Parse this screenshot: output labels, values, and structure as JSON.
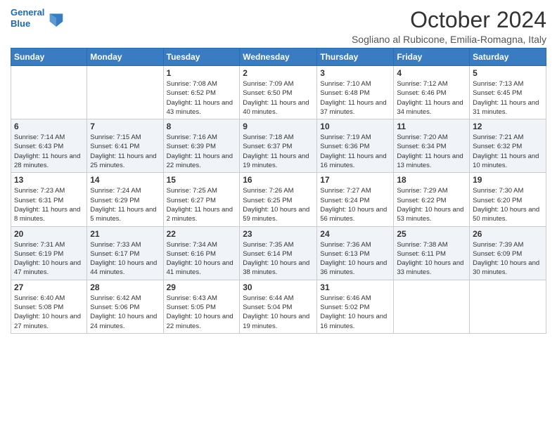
{
  "header": {
    "logo_line1": "General",
    "logo_line2": "Blue",
    "month_title": "October 2024",
    "subtitle": "Sogliano al Rubicone, Emilia-Romagna, Italy"
  },
  "weekdays": [
    "Sunday",
    "Monday",
    "Tuesday",
    "Wednesday",
    "Thursday",
    "Friday",
    "Saturday"
  ],
  "weeks": [
    [
      {
        "day": "",
        "info": ""
      },
      {
        "day": "",
        "info": ""
      },
      {
        "day": "1",
        "info": "Sunrise: 7:08 AM\nSunset: 6:52 PM\nDaylight: 11 hours and 43 minutes."
      },
      {
        "day": "2",
        "info": "Sunrise: 7:09 AM\nSunset: 6:50 PM\nDaylight: 11 hours and 40 minutes."
      },
      {
        "day": "3",
        "info": "Sunrise: 7:10 AM\nSunset: 6:48 PM\nDaylight: 11 hours and 37 minutes."
      },
      {
        "day": "4",
        "info": "Sunrise: 7:12 AM\nSunset: 6:46 PM\nDaylight: 11 hours and 34 minutes."
      },
      {
        "day": "5",
        "info": "Sunrise: 7:13 AM\nSunset: 6:45 PM\nDaylight: 11 hours and 31 minutes."
      }
    ],
    [
      {
        "day": "6",
        "info": "Sunrise: 7:14 AM\nSunset: 6:43 PM\nDaylight: 11 hours and 28 minutes."
      },
      {
        "day": "7",
        "info": "Sunrise: 7:15 AM\nSunset: 6:41 PM\nDaylight: 11 hours and 25 minutes."
      },
      {
        "day": "8",
        "info": "Sunrise: 7:16 AM\nSunset: 6:39 PM\nDaylight: 11 hours and 22 minutes."
      },
      {
        "day": "9",
        "info": "Sunrise: 7:18 AM\nSunset: 6:37 PM\nDaylight: 11 hours and 19 minutes."
      },
      {
        "day": "10",
        "info": "Sunrise: 7:19 AM\nSunset: 6:36 PM\nDaylight: 11 hours and 16 minutes."
      },
      {
        "day": "11",
        "info": "Sunrise: 7:20 AM\nSunset: 6:34 PM\nDaylight: 11 hours and 13 minutes."
      },
      {
        "day": "12",
        "info": "Sunrise: 7:21 AM\nSunset: 6:32 PM\nDaylight: 11 hours and 10 minutes."
      }
    ],
    [
      {
        "day": "13",
        "info": "Sunrise: 7:23 AM\nSunset: 6:31 PM\nDaylight: 11 hours and 8 minutes."
      },
      {
        "day": "14",
        "info": "Sunrise: 7:24 AM\nSunset: 6:29 PM\nDaylight: 11 hours and 5 minutes."
      },
      {
        "day": "15",
        "info": "Sunrise: 7:25 AM\nSunset: 6:27 PM\nDaylight: 11 hours and 2 minutes."
      },
      {
        "day": "16",
        "info": "Sunrise: 7:26 AM\nSunset: 6:25 PM\nDaylight: 10 hours and 59 minutes."
      },
      {
        "day": "17",
        "info": "Sunrise: 7:27 AM\nSunset: 6:24 PM\nDaylight: 10 hours and 56 minutes."
      },
      {
        "day": "18",
        "info": "Sunrise: 7:29 AM\nSunset: 6:22 PM\nDaylight: 10 hours and 53 minutes."
      },
      {
        "day": "19",
        "info": "Sunrise: 7:30 AM\nSunset: 6:20 PM\nDaylight: 10 hours and 50 minutes."
      }
    ],
    [
      {
        "day": "20",
        "info": "Sunrise: 7:31 AM\nSunset: 6:19 PM\nDaylight: 10 hours and 47 minutes."
      },
      {
        "day": "21",
        "info": "Sunrise: 7:33 AM\nSunset: 6:17 PM\nDaylight: 10 hours and 44 minutes."
      },
      {
        "day": "22",
        "info": "Sunrise: 7:34 AM\nSunset: 6:16 PM\nDaylight: 10 hours and 41 minutes."
      },
      {
        "day": "23",
        "info": "Sunrise: 7:35 AM\nSunset: 6:14 PM\nDaylight: 10 hours and 38 minutes."
      },
      {
        "day": "24",
        "info": "Sunrise: 7:36 AM\nSunset: 6:13 PM\nDaylight: 10 hours and 36 minutes."
      },
      {
        "day": "25",
        "info": "Sunrise: 7:38 AM\nSunset: 6:11 PM\nDaylight: 10 hours and 33 minutes."
      },
      {
        "day": "26",
        "info": "Sunrise: 7:39 AM\nSunset: 6:09 PM\nDaylight: 10 hours and 30 minutes."
      }
    ],
    [
      {
        "day": "27",
        "info": "Sunrise: 6:40 AM\nSunset: 5:08 PM\nDaylight: 10 hours and 27 minutes."
      },
      {
        "day": "28",
        "info": "Sunrise: 6:42 AM\nSunset: 5:06 PM\nDaylight: 10 hours and 24 minutes."
      },
      {
        "day": "29",
        "info": "Sunrise: 6:43 AM\nSunset: 5:05 PM\nDaylight: 10 hours and 22 minutes."
      },
      {
        "day": "30",
        "info": "Sunrise: 6:44 AM\nSunset: 5:04 PM\nDaylight: 10 hours and 19 minutes."
      },
      {
        "day": "31",
        "info": "Sunrise: 6:46 AM\nSunset: 5:02 PM\nDaylight: 10 hours and 16 minutes."
      },
      {
        "day": "",
        "info": ""
      },
      {
        "day": "",
        "info": ""
      }
    ]
  ]
}
